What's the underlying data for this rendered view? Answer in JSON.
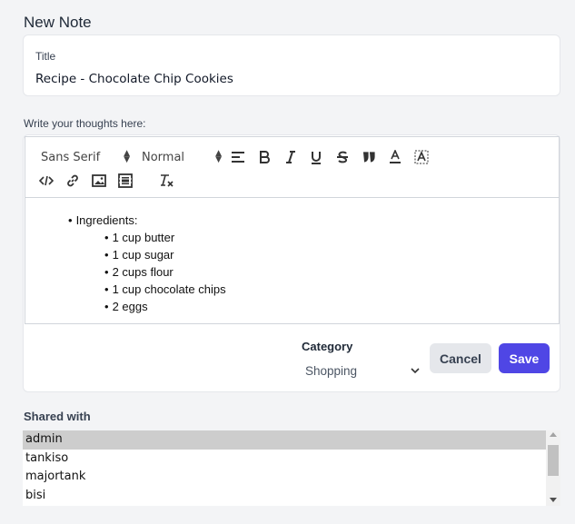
{
  "page": {
    "title": "New Note"
  },
  "title_field": {
    "label": "Title",
    "value": "Recipe - Chocolate Chip Cookies"
  },
  "editor": {
    "label": "Write your thoughts here:",
    "toolbar": {
      "font": "Sans Serif",
      "size": "Normal",
      "buttons": [
        "align-icon",
        "bold-icon",
        "italic-icon",
        "underline-icon",
        "strike-icon",
        "blockquote-icon",
        "font-color-icon",
        "background-color-icon",
        "code-block-icon",
        "link-icon",
        "image-icon",
        "video-icon",
        "clear-format-icon"
      ]
    },
    "content": {
      "heading": "Ingredients:",
      "items": [
        "1 cup butter",
        "1 cup sugar",
        "2 cups flour",
        "1 cup chocolate chips",
        "2 eggs"
      ]
    }
  },
  "category": {
    "label": "Category",
    "selected": "Shopping"
  },
  "actions": {
    "cancel_label": "Cancel",
    "save_label": "Save"
  },
  "shared": {
    "label": "Shared with",
    "users": [
      "admin",
      "tankiso",
      "majortank",
      "bisi"
    ],
    "selected": "admin"
  },
  "colors": {
    "primary": "#4f46e5",
    "cancel_bg": "#e5e7eb",
    "page_bg": "#f3f4f6"
  }
}
